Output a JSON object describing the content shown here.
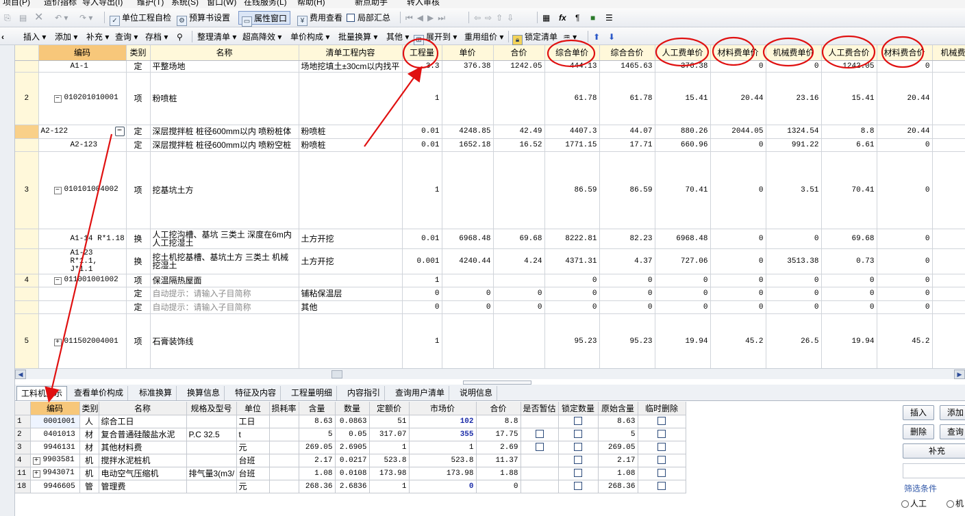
{
  "menubar": {
    "items": [
      "项目(P)",
      "造价指标",
      "导入导出(I)",
      "维护(T)",
      "系统(S)",
      "窗口(W)",
      "在线服务(L)",
      "帮助(H)",
      "新点助手",
      "转入审核"
    ]
  },
  "toolbar1": {
    "check_label": "单位工程自检",
    "budget_label": "预算书设置",
    "property_window": "属性窗口",
    "fee_view": "费用查看",
    "partial_sum": "局部汇总"
  },
  "toolbar2": {
    "insert": "插入",
    "add": "添加",
    "supplement": "补充",
    "query": "查询",
    "archive": "存档",
    "organize": "整理清单",
    "over_height": "超高降效",
    "unit_price_comp": "单价构成",
    "batch_convert": "批量换算",
    "other": "其他",
    "expand_to": "展开到",
    "reuse_price": "重用组价",
    "lock_list": "锁定清单"
  },
  "main_grid": {
    "headers": [
      "编码",
      "类别",
      "名称",
      "清单工程内容",
      "工程量",
      "单价",
      "合价",
      "综合单价",
      "综合合价",
      "人工费单价",
      "材料费单价",
      "机械费单价",
      "人工费合价",
      "材料费合价",
      "机械费"
    ],
    "rows": [
      {
        "num": "",
        "code": "A1-1",
        "type": "定",
        "name": "平整场地",
        "content": "场地挖填土±30cm以内找平",
        "qty": "3.3",
        "price": "376.38",
        "total": "1242.05",
        "comp_price": "444.13",
        "comp_total": "1465.63",
        "labor_p": "376.38",
        "mat_p": "0",
        "mach_p": "0",
        "labor_t": "1242.05",
        "mat_t": "0"
      },
      {
        "num": "2",
        "code": "010201010001",
        "type": "项",
        "name": "粉喷桩",
        "content": "",
        "qty": "1",
        "price": "",
        "total": "",
        "comp_price": "61.78",
        "comp_total": "61.78",
        "labor_p": "15.41",
        "mat_p": "20.44",
        "mach_p": "23.16",
        "labor_t": "15.41",
        "mat_t": "20.44"
      },
      {
        "num": "",
        "code": "A2-122",
        "type": "定",
        "name": "深层搅拌桩 桩径600mm以内 喷粉桩体",
        "content": "粉喷桩",
        "qty": "0.01",
        "price": "4248.85",
        "total": "42.49",
        "comp_price": "4407.3",
        "comp_total": "44.07",
        "labor_p": "880.26",
        "mat_p": "2044.05",
        "mach_p": "1324.54",
        "labor_t": "8.8",
        "mat_t": "20.44"
      },
      {
        "num": "",
        "code": "A2-123",
        "type": "定",
        "name": "深层搅拌桩 桩径600mm以内 喷粉空桩",
        "content": "粉喷桩",
        "qty": "0.01",
        "price": "1652.18",
        "total": "16.52",
        "comp_price": "1771.15",
        "comp_total": "17.71",
        "labor_p": "660.96",
        "mat_p": "0",
        "mach_p": "991.22",
        "labor_t": "6.61",
        "mat_t": "0"
      },
      {
        "num": "3",
        "code": "010101004002",
        "type": "项",
        "name": "挖基坑土方",
        "content": "",
        "qty": "1",
        "price": "",
        "total": "",
        "comp_price": "86.59",
        "comp_total": "86.59",
        "labor_p": "70.41",
        "mat_p": "0",
        "mach_p": "3.51",
        "labor_t": "70.41",
        "mat_t": "0"
      },
      {
        "num": "",
        "code": "A1-14 R*1.18",
        "type": "换",
        "name": "人工挖沟槽、基坑 三类土 深度在6m内 人工挖湿土",
        "content": "土方开挖",
        "qty": "0.01",
        "price": "6968.48",
        "total": "69.68",
        "comp_price": "8222.81",
        "comp_total": "82.23",
        "labor_p": "6968.48",
        "mat_p": "0",
        "mach_p": "0",
        "labor_t": "69.68",
        "mat_t": "0"
      },
      {
        "num": "",
        "code": "A1-23 R*1.1, J*1.1",
        "type": "换",
        "name": "挖土机挖基槽、基坑土方 三类土 机械挖湿土",
        "content": "土方开挖",
        "qty": "0.001",
        "price": "4240.44",
        "total": "4.24",
        "comp_price": "4371.31",
        "comp_total": "4.37",
        "labor_p": "727.06",
        "mat_p": "0",
        "mach_p": "3513.38",
        "labor_t": "0.73",
        "mat_t": "0"
      },
      {
        "num": "4",
        "code": "011001001002",
        "type": "项",
        "name": "保温隔热屋面",
        "content": "",
        "qty": "1",
        "price": "",
        "total": "",
        "comp_price": "0",
        "comp_total": "0",
        "labor_p": "0",
        "mat_p": "0",
        "mach_p": "0",
        "labor_t": "0",
        "mat_t": "0"
      },
      {
        "num": "",
        "code": "",
        "type": "定",
        "name": "自动提示：请输入子目简称",
        "content": "铺粘保温层",
        "qty": "0",
        "price": "0",
        "total": "0",
        "comp_price": "0",
        "comp_total": "0",
        "labor_p": "0",
        "mat_p": "0",
        "mach_p": "0",
        "labor_t": "0",
        "mat_t": "0"
      },
      {
        "num": "",
        "code": "",
        "type": "定",
        "name": "自动提示：请输入子目简称",
        "content": "其他",
        "qty": "0",
        "price": "0",
        "total": "0",
        "comp_price": "0",
        "comp_total": "0",
        "labor_p": "0",
        "mat_p": "0",
        "mach_p": "0",
        "labor_t": "0",
        "mat_t": "0"
      },
      {
        "num": "5",
        "code": "011502004001",
        "type": "项",
        "name": "石膏装饰线",
        "content": "",
        "qty": "1",
        "price": "",
        "total": "",
        "comp_price": "95.23",
        "comp_total": "95.23",
        "labor_p": "19.94",
        "mat_p": "45.2",
        "mach_p": "26.5",
        "labor_t": "19.94",
        "mat_t": "45.2"
      }
    ]
  },
  "bottom_tabs": [
    "工料机显示",
    "查看单价构成",
    "标准换算",
    "换算信息",
    "特征及内容",
    "工程量明细",
    "内容指引",
    "查询用户清单",
    "说明信息"
  ],
  "sub_grid": {
    "headers": [
      "编码",
      "类别",
      "名称",
      "规格及型号",
      "单位",
      "损耗率",
      "含量",
      "数量",
      "定额价",
      "市场价",
      "合价",
      "是否暂估",
      "锁定数量",
      "原始含量",
      "临时删除"
    ],
    "rows": [
      {
        "num": "1",
        "code": "0001001",
        "type": "人",
        "name": "综合工日",
        "spec": "",
        "unit": "工日",
        "loss": "",
        "content": "8.63",
        "qty": "0.0863",
        "quota": "51",
        "market": "102",
        "total": "8.8",
        "orig": "8.63"
      },
      {
        "num": "2",
        "code": "0401013",
        "type": "材",
        "name": "复合普通硅酸盐水泥",
        "spec": "P.C 32.5",
        "unit": "t",
        "loss": "",
        "content": "5",
        "qty": "0.05",
        "quota": "317.07",
        "market": "355",
        "total": "17.75",
        "orig": "5"
      },
      {
        "num": "3",
        "code": "9946131",
        "type": "材",
        "name": "其他材料费",
        "spec": "",
        "unit": "元",
        "loss": "",
        "content": "269.05",
        "qty": "2.6905",
        "quota": "1",
        "market": "1",
        "total": "2.69",
        "orig": "269.05"
      },
      {
        "num": "4",
        "code": "9903581",
        "type": "机",
        "name": "搅拌水泥桩机",
        "spec": "",
        "unit": "台班",
        "loss": "",
        "content": "2.17",
        "qty": "0.0217",
        "quota": "523.8",
        "market": "523.8",
        "total": "11.37",
        "orig": "2.17"
      },
      {
        "num": "11",
        "code": "9943071",
        "type": "机",
        "name": "电动空气压缩机",
        "spec": "排气量3(m3/",
        "unit": "台班",
        "loss": "",
        "content": "1.08",
        "qty": "0.0108",
        "quota": "173.98",
        "market": "173.98",
        "total": "1.88",
        "orig": "1.08"
      },
      {
        "num": "18",
        "code": "9946605",
        "type": "管",
        "name": "管理费",
        "spec": "",
        "unit": "元",
        "loss": "",
        "content": "268.36",
        "qty": "2.6836",
        "quota": "1",
        "market": "0",
        "total": "0",
        "orig": "268.36"
      }
    ]
  },
  "side_panel": {
    "insert": "插入",
    "add": "添加",
    "delete": "删除",
    "query": "查询",
    "supplement": "补充",
    "filter_title": "筛选条件",
    "labor": "人工",
    "machine": "机"
  },
  "colors": {
    "annotation": "#e01010",
    "header_bg": "#fff8da",
    "header_highlight": "#f7c77a"
  }
}
